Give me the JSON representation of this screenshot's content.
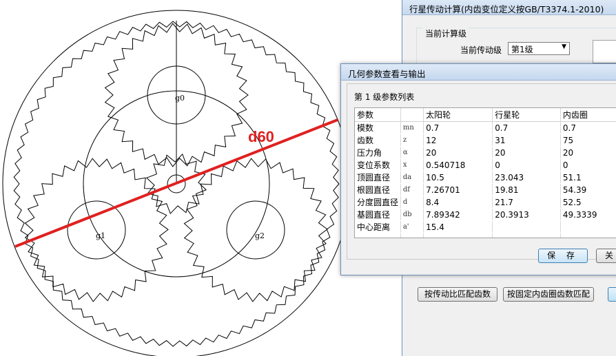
{
  "back_window": {
    "title": "行星传动计算(内齿变位定义按GB/T3374.1-2010)",
    "group_label": "当前计算级",
    "stage_label": "当前传动级",
    "stage_value": "第1级",
    "button_match_ratio": "按传动比匹配齿数",
    "button_match_ring": "按固定内齿圈齿数匹配"
  },
  "dialog": {
    "title": "几何参数查看与输出",
    "panel_title": "第 1 级参数列表",
    "columns": [
      "参数",
      "",
      "太阳轮",
      "行星轮",
      "内齿圈"
    ],
    "rows": [
      {
        "name": "模数",
        "sym": "mn",
        "sun": "0.7",
        "planet": "0.7",
        "ring": "0.7"
      },
      {
        "name": "齿数",
        "sym": "z",
        "sun": "12",
        "planet": "31",
        "ring": "75"
      },
      {
        "name": "压力角",
        "sym": "α",
        "sun": "20",
        "planet": "20",
        "ring": "20"
      },
      {
        "name": "变位系数",
        "sym": "x",
        "sun": "0.540718",
        "planet": "0",
        "ring": "0"
      },
      {
        "name": "顶圆直径",
        "sym": "da",
        "sun": "10.5",
        "planet": "23.043",
        "ring": "51.1"
      },
      {
        "name": "根圆直径",
        "sym": "df",
        "sun": "7.26701",
        "planet": "19.81",
        "ring": "54.39"
      },
      {
        "name": "分度圆直径",
        "sym": "d",
        "sun": "8.4",
        "planet": "21.7",
        "ring": "52.5"
      },
      {
        "name": "基圆直径",
        "sym": "db",
        "sun": "7.89342",
        "planet": "20.3913",
        "ring": "49.3339"
      },
      {
        "name": "中心距离",
        "sym": "a'",
        "sun": "15.4",
        "planet": "",
        "ring": ""
      }
    ],
    "save_label": "保 存",
    "close_label": "关"
  },
  "drawing": {
    "annotation": "d60",
    "planet_labels": [
      "g0",
      "g1",
      "g2"
    ],
    "sun_teeth": 12,
    "planet_teeth": 31,
    "ring_teeth": 75,
    "annotation_color": "#e02020"
  }
}
